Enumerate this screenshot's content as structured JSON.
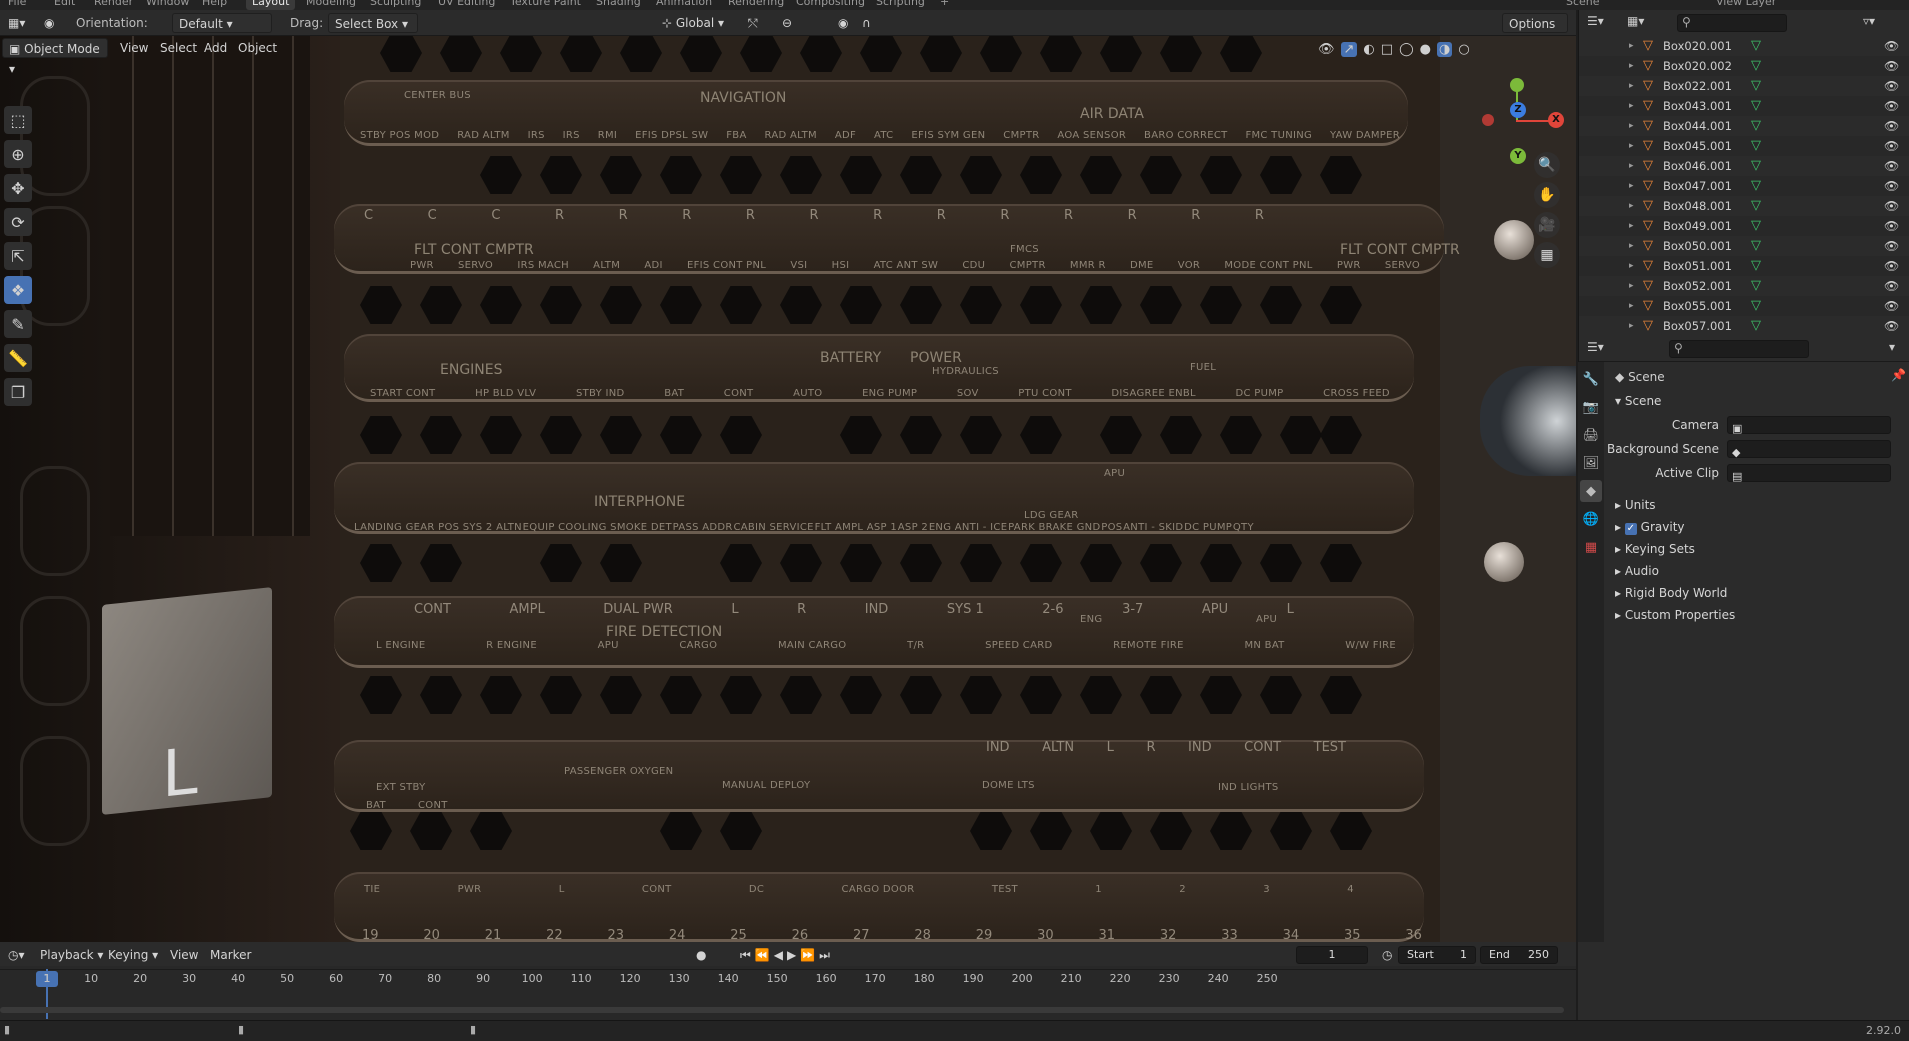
{
  "topbar": {
    "tabs": [
      "File",
      "Edit",
      "Render",
      "Window",
      "Help",
      "Layout",
      "Modeling",
      "Sculpting",
      "UV Editing",
      "Texture Paint",
      "Shading",
      "Animation",
      "Rendering",
      "Compositing",
      "Scripting",
      "+"
    ],
    "active": "Layout",
    "scene": "Scene",
    "view_layer": "View Layer"
  },
  "header": {
    "orientation_label": "Orientation:",
    "orientation_value": "Default",
    "drag_label": "Drag:",
    "drag_value": "Select Box",
    "transform_orientation": "Global",
    "options_label": "Options"
  },
  "view_header": {
    "mode": "Object Mode",
    "menus": [
      "View",
      "Select",
      "Add",
      "Object"
    ]
  },
  "panel_text": {
    "row1": {
      "center_bus": "CENTER BUS",
      "navigation": "NAVIGATION",
      "air_data": "AIR DATA",
      "labels": [
        "STBY POS MOD",
        "RAD ALTM",
        "IRS",
        "IRS",
        "RMI",
        "EFIS DPSL SW",
        "FBA",
        "RAD ALTM",
        "ADF",
        "ATC",
        "EFIS SYM GEN",
        "CMPTR",
        "AOA SENSOR",
        "BARO CORRECT",
        "FMC TUNING",
        "YAW DAMPER"
      ]
    },
    "row2": {
      "c_labels": [
        "C",
        "C",
        "C",
        "R",
        "R",
        "R",
        "R",
        "R",
        "R",
        "R",
        "R",
        "R",
        "R",
        "R",
        "R"
      ],
      "flt_cont": "FLT CONT CMPTR",
      "flt_cont_right": "FLT CONT CMPTR",
      "fmcs": "FMCS",
      "labels": [
        "PWR",
        "SERVO",
        "IRS MACH",
        "ALTM",
        "ADI",
        "EFIS CONT PNL",
        "VSI",
        "HSI",
        "ATC ANT SW",
        "CDU",
        "CMPTR",
        "MMR R",
        "DME",
        "VOR",
        "MODE CONT PNL",
        "PWR",
        "SERVO"
      ]
    },
    "row3": {
      "engines": "ENGINES",
      "battery": "BATTERY",
      "power": "POWER",
      "hydraulics": "HYDRAULICS",
      "fuel": "FUEL",
      "labels": [
        "START CONT",
        "HP BLD VLV",
        "STBY IND",
        "BAT",
        "CONT",
        "AUTO",
        "ENG PUMP",
        "SOV",
        "PTU CONT",
        "DISAGREE ENBL",
        "DC PUMP",
        "CROSS FEED"
      ]
    },
    "row4": {
      "interphone": "INTERPHONE",
      "ldg_gear": "LDG GEAR",
      "apu": "APU",
      "labels": [
        "LANDING GEAR POS SYS 2 ALTN",
        "EQUIP COOLING SMOKE DET",
        "PASS ADDR",
        "CABIN SERVICE",
        "FLT AMPL ASP 1",
        "ASP 2",
        "ENG ANTI - ICE",
        "PARK BRAKE GND",
        "POS",
        "ANTI - SKID",
        "DC PUMP",
        "QTY"
      ]
    },
    "row5": {
      "top_labels": [
        "CONT",
        "AMPL",
        "DUAL PWR",
        "L",
        "R",
        "IND",
        "SYS 1",
        "2-6",
        "3-7",
        "APU",
        "L"
      ],
      "fire": "FIRE DETECTION",
      "eng": "ENG",
      "apu": "APU",
      "labels": [
        "L ENGINE",
        "R ENGINE",
        "APU",
        "CARGO",
        "MAIN CARGO",
        "T/R",
        "SPEED CARD",
        "REMOTE FIRE",
        "MN BAT",
        "W/W FIRE"
      ]
    },
    "row6": {
      "top_labels": [
        "IND",
        "ALTN",
        "L",
        "R",
        "IND",
        "CONT",
        "TEST"
      ],
      "oxygen": "PASSENGER OXYGEN",
      "ext_stby": "EXT STBY",
      "ind_lights": "IND LIGHTS",
      "labels": [
        "BAT",
        "CONT",
        "MANUAL DEPLOY",
        "DOME LTS"
      ]
    },
    "row7": {
      "labels": [
        "TIE",
        "PWR",
        "L",
        "CONT",
        "DC",
        "CARGO DOOR",
        "TEST",
        "1",
        "2",
        "3",
        "4"
      ],
      "numbers": [
        "19",
        "20",
        "21",
        "22",
        "23",
        "24",
        "25",
        "26",
        "27",
        "28",
        "29",
        "30",
        "31",
        "32",
        "33",
        "34",
        "35",
        "36"
      ]
    }
  },
  "gizmo": {
    "x": "X",
    "y": "Y",
    "z": "Z"
  },
  "outliner": {
    "items": [
      "Box020.001",
      "Box020.002",
      "Box022.001",
      "Box043.001",
      "Box044.001",
      "Box045.001",
      "Box046.001",
      "Box047.001",
      "Box048.001",
      "Box049.001",
      "Box050.001",
      "Box051.001",
      "Box052.001",
      "Box055.001",
      "Box057.001"
    ]
  },
  "properties": {
    "title": "Scene",
    "section": "Scene",
    "camera_label": "Camera",
    "bg_label": "Background Scene",
    "clip_label": "Active Clip",
    "panels": [
      "Units",
      "Gravity",
      "Keying Sets",
      "Audio",
      "Rigid Body World",
      "Custom Properties"
    ],
    "gravity_checked": true
  },
  "timeline": {
    "menus": [
      "Playback",
      "Keying",
      "View",
      "Marker"
    ],
    "current_frame": "1",
    "start_label": "Start",
    "start_value": "1",
    "end_label": "End",
    "end_value": "250",
    "ticks": [
      "1",
      "10",
      "20",
      "30",
      "40",
      "50",
      "60",
      "70",
      "80",
      "90",
      "100",
      "110",
      "120",
      "130",
      "140",
      "150",
      "160",
      "170",
      "180",
      "190",
      "200",
      "210",
      "220",
      "230",
      "240",
      "250"
    ]
  },
  "status": {
    "version": "2.92.0"
  },
  "colors": {
    "accent": "#4772b3",
    "x_axis": "#e0453a",
    "y_axis": "#7cba3a",
    "z_axis": "#3b7de0",
    "mesh": "#3ec26a",
    "object": "#e8853a"
  }
}
